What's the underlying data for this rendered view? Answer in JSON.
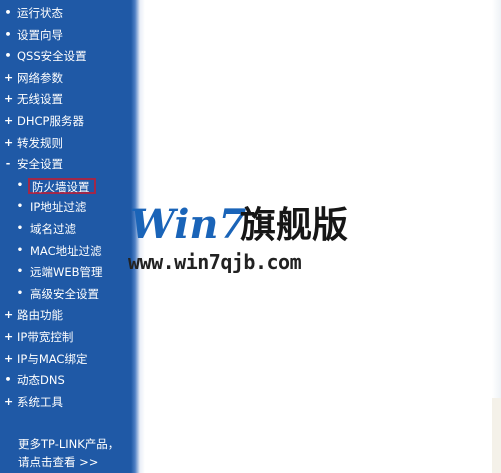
{
  "sidebar": {
    "items": [
      {
        "label": "运行状态",
        "bullet": "•",
        "level": 0
      },
      {
        "label": "设置向导",
        "bullet": "•",
        "level": 0
      },
      {
        "label": "QSS安全设置",
        "bullet": "•",
        "level": 0
      },
      {
        "label": "网络参数",
        "bullet": "+",
        "level": 0
      },
      {
        "label": "无线设置",
        "bullet": "+",
        "level": 0
      },
      {
        "label": "DHCP服务器",
        "bullet": "+",
        "level": 0
      },
      {
        "label": "转发规则",
        "bullet": "+",
        "level": 0
      },
      {
        "label": "安全设置",
        "bullet": "-",
        "level": 0
      },
      {
        "label": "防火墙设置",
        "bullet": "•",
        "level": 1,
        "selected": true
      },
      {
        "label": "IP地址过滤",
        "bullet": "•",
        "level": 1
      },
      {
        "label": "域名过滤",
        "bullet": "•",
        "level": 1
      },
      {
        "label": "MAC地址过滤",
        "bullet": "•",
        "level": 1
      },
      {
        "label": "远端WEB管理",
        "bullet": "•",
        "level": 1
      },
      {
        "label": "高级安全设置",
        "bullet": "•",
        "level": 1
      },
      {
        "label": "路由功能",
        "bullet": "+",
        "level": 0
      },
      {
        "label": "IP带宽控制",
        "bullet": "+",
        "level": 0
      },
      {
        "label": "IP与MAC绑定",
        "bullet": "+",
        "level": 0
      },
      {
        "label": "动态DNS",
        "bullet": "•",
        "level": 0
      },
      {
        "label": "系统工具",
        "bullet": "+",
        "level": 0
      }
    ],
    "footer_line1": "更多TP-LINK产品，",
    "footer_line2": "请点击查看 >>"
  },
  "watermark": {
    "brand": "Win7",
    "brand_cn": "旗舰版",
    "url": "www.win7qjb.com"
  },
  "colors": {
    "sidebar_bg": "#1f59a6",
    "selected_border": "#a0284a",
    "brand_blue": "#1a64b8"
  }
}
